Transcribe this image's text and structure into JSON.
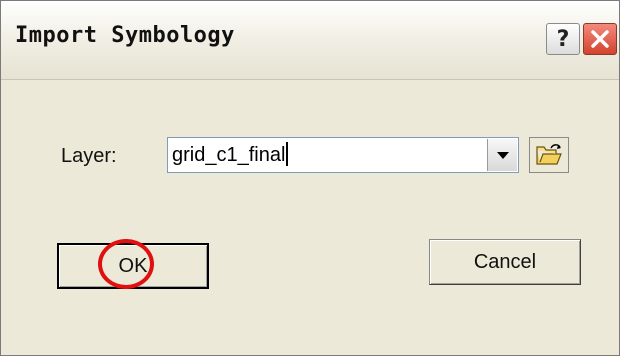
{
  "window": {
    "title": "Import Symbology",
    "help_label": "?"
  },
  "form": {
    "layer_label": "Layer:",
    "layer_value": "grid_c1_final"
  },
  "buttons": {
    "ok_label": "OK",
    "cancel_label": "Cancel"
  },
  "icons": {
    "help": "question-mark-icon",
    "close": "close-x-icon",
    "dropdown": "chevron-down-icon",
    "open_folder": "open-folder-icon"
  },
  "colors": {
    "dialog_bg": "#ece9d8",
    "close_button": "#d2432f",
    "highlight_circle": "#e01010",
    "combo_border": "#7f9db9"
  }
}
